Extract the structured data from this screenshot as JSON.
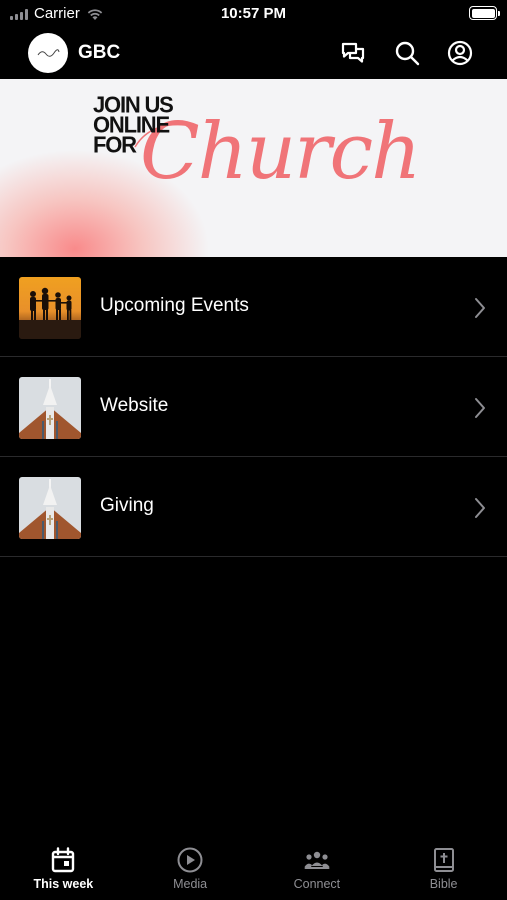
{
  "status_bar": {
    "carrier": "Carrier",
    "time": "10:57 PM"
  },
  "header": {
    "title": "GBC",
    "logo_icon": "gbc-logo-icon",
    "actions": [
      {
        "icon": "chat-icon"
      },
      {
        "icon": "search-icon"
      },
      {
        "icon": "profile-icon"
      }
    ]
  },
  "banner": {
    "line1": "JOIN US",
    "line2": "ONLINE",
    "line3": "FOR",
    "script_text": "Church",
    "accent_color": "#f07478"
  },
  "list": {
    "items": [
      {
        "label": "Upcoming Events",
        "thumb": "silhouette-sunset-thumbnail"
      },
      {
        "label": "Website",
        "thumb": "church-steeple-thumbnail"
      },
      {
        "label": "Giving",
        "thumb": "church-steeple-thumbnail"
      }
    ]
  },
  "tabbar": {
    "tabs": [
      {
        "label": "This week",
        "icon": "calendar-icon",
        "active": true
      },
      {
        "label": "Media",
        "icon": "play-circle-icon",
        "active": false
      },
      {
        "label": "Connect",
        "icon": "people-icon",
        "active": false
      },
      {
        "label": "Bible",
        "icon": "bible-icon",
        "active": false
      }
    ]
  }
}
